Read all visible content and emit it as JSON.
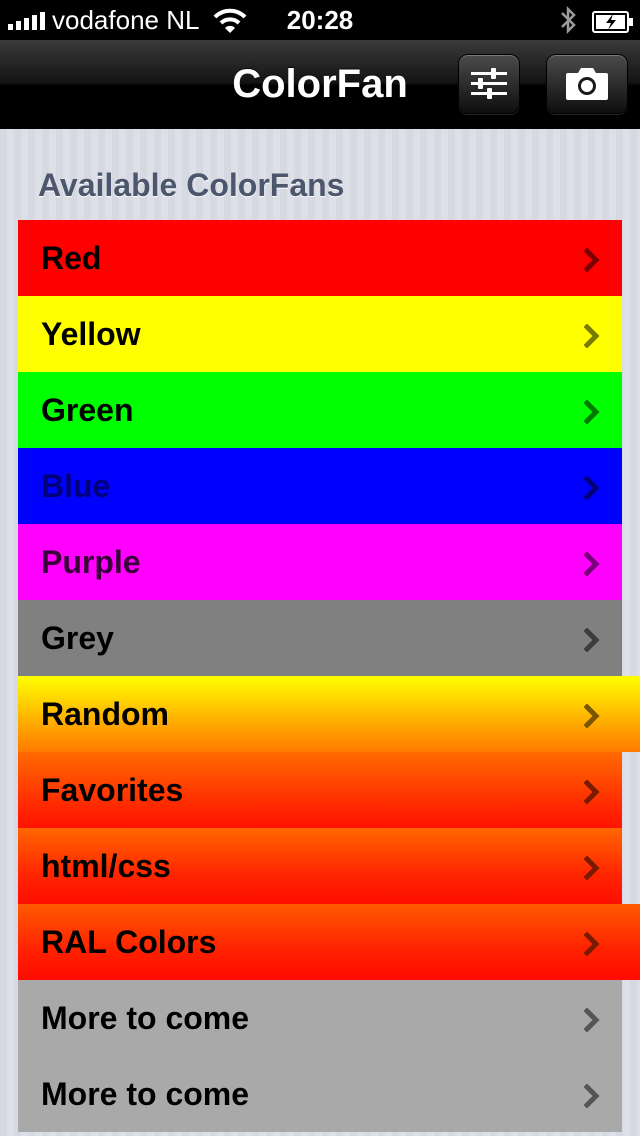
{
  "status_bar": {
    "carrier": "vodafone NL",
    "time": "20:28"
  },
  "nav": {
    "title": "ColorFan"
  },
  "section": {
    "title": "Available ColorFans"
  },
  "items": [
    {
      "label": "Red",
      "color": "#ff0000"
    },
    {
      "label": "Yellow",
      "color": "#ffff00"
    },
    {
      "label": "Green",
      "color": "#00ff00"
    },
    {
      "label": "Blue",
      "color": "#0000ff"
    },
    {
      "label": "Purple",
      "color": "#ff00ff"
    },
    {
      "label": "Grey",
      "color": "#808080"
    },
    {
      "label": "Random",
      "color": "#ffc000"
    },
    {
      "label": "Favorites",
      "color": "#ff3a00"
    },
    {
      "label": "html/css",
      "color": "#ff3000"
    },
    {
      "label": "RAL Colors",
      "color": "#ff3000"
    },
    {
      "label": "More to come",
      "color": "#a9a9a9"
    },
    {
      "label": "More to come",
      "color": "#a9a9a9"
    }
  ]
}
